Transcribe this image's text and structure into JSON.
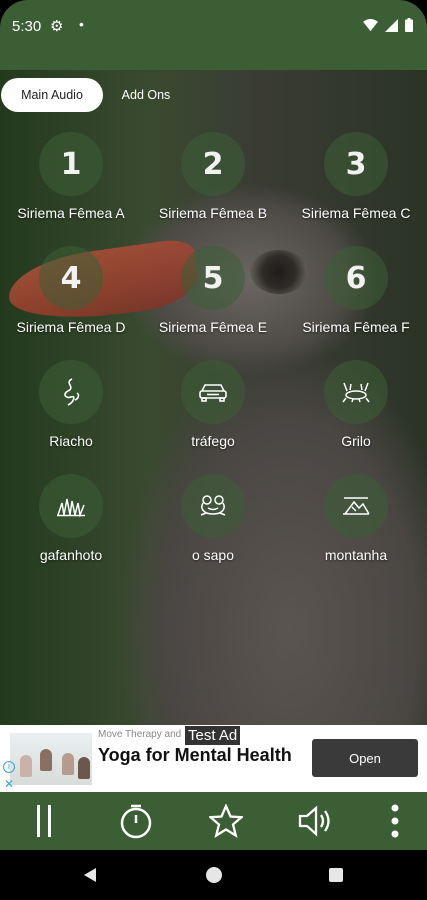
{
  "status_bar": {
    "time": "5:30"
  },
  "tabs": [
    {
      "label": "Main Audio",
      "active": true
    },
    {
      "label": "Add Ons",
      "active": false
    }
  ],
  "sounds": [
    {
      "label": "Siriema Fêmea A",
      "number": "1",
      "icon": "number-icon"
    },
    {
      "label": "Siriema Fêmea B",
      "number": "2",
      "icon": "number-icon"
    },
    {
      "label": "Siriema Fêmea C",
      "number": "3",
      "icon": "number-icon"
    },
    {
      "label": "Siriema Fêmea D",
      "number": "4",
      "icon": "number-icon"
    },
    {
      "label": "Siriema Fêmea E",
      "number": "5",
      "icon": "number-icon"
    },
    {
      "label": "Siriema Fêmea F",
      "number": "6",
      "icon": "number-icon"
    },
    {
      "label": "Riacho",
      "icon": "stream-icon"
    },
    {
      "label": "tráfego",
      "icon": "car-icon"
    },
    {
      "label": "Grilo",
      "icon": "cricket-icon"
    },
    {
      "label": "gafanhoto",
      "icon": "grass-icon"
    },
    {
      "label": "o sapo",
      "icon": "frog-icon"
    },
    {
      "label": "montanha",
      "icon": "mountain-icon"
    }
  ],
  "ad": {
    "sponsor_text": "Move Therapy and",
    "test_label": "Test Ad",
    "headline": "Yoga for Mental Health",
    "button_label": "Open"
  },
  "player_controls": [
    "pause-icon",
    "timer-icon",
    "star-icon",
    "volume-icon",
    "more-vert-icon"
  ],
  "colors": {
    "primary": "#3b5e34",
    "circle": "#3c5f36"
  }
}
